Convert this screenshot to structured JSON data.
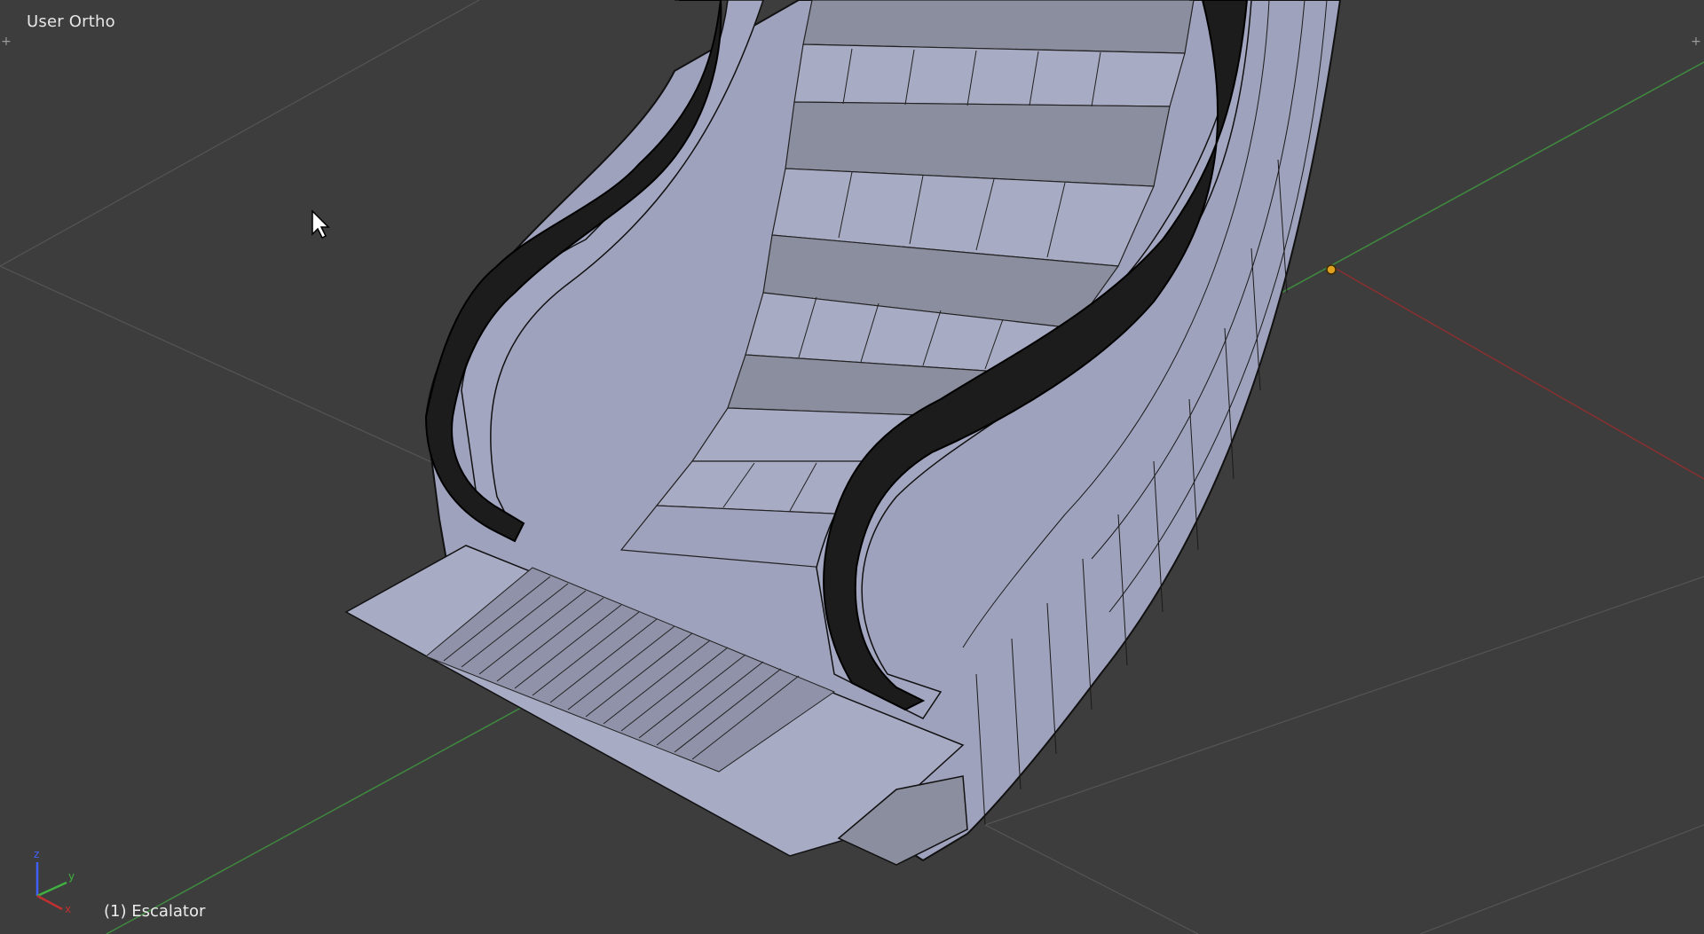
{
  "viewport": {
    "view_name": "User Ortho",
    "active_object": "(1) Escalator",
    "background_color": "#3d3d3d",
    "grid_color": "#555555",
    "x_axis_color": "#8a3030",
    "y_axis_color": "#3f8a3f",
    "mesh_face_color": "#9fa2bd",
    "mesh_wire_color": "#111111",
    "handrail_color": "#1c1c1c",
    "origin_color": "#e0a020"
  },
  "axes_gizmo": {
    "x_label": "x",
    "y_label": "y",
    "z_label": "z"
  },
  "icons": {
    "left_corner": "plus-icon",
    "right_corner": "plus-icon",
    "cursor": "mouse-pointer-icon"
  }
}
